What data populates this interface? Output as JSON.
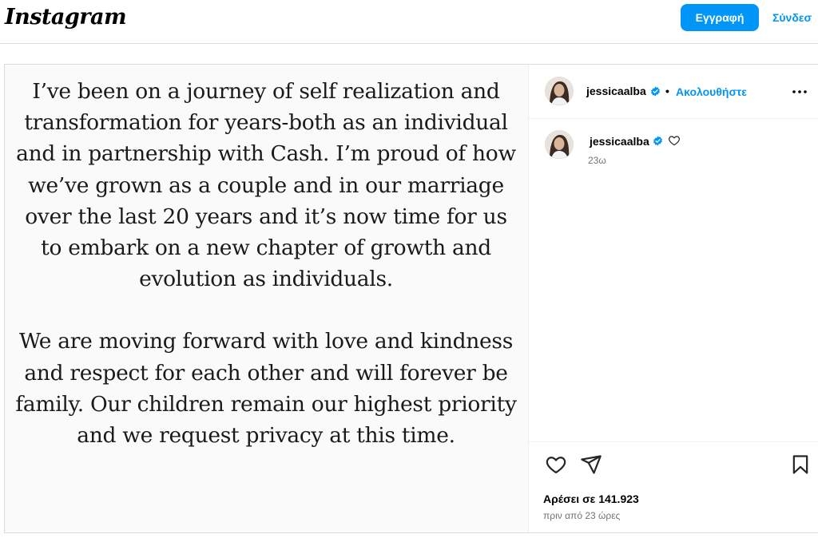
{
  "header": {
    "logo_text": "Instagram",
    "signup_label": "Εγγραφή",
    "login_label": "Σύνδεσ"
  },
  "post": {
    "media_text": {
      "paragraph1": "I’ve been on a journey of self realization and transformation for years-both as an individual and in partnership with Cash. I’m proud of how we’ve grown as a couple and in our marriage over the last 20 years and it’s now time for us to embark on a new chapter of growth and evolution as individuals.",
      "paragraph2": "We are moving forward with love and kindness and respect for each other and will forever be family. Our children remain our highest priority and we request privacy at this time."
    },
    "author": {
      "username": "jessicaalba",
      "verified": true,
      "separator": "•",
      "follow_label": "Ακολουθήστε"
    },
    "caption": {
      "username": "jessicaalba",
      "time_ago": "23ω"
    },
    "likes_text": "Αρέσει σε 141.923",
    "posted_ago": "πριν από 23 ώρες"
  },
  "icons": {
    "more": "more-options-icon",
    "verified": "verified-badge-icon",
    "like": "heart-icon",
    "share": "paper-plane-icon",
    "save": "bookmark-icon"
  },
  "colors": {
    "accent": "#0095f6",
    "border": "#dbdbdb",
    "secondary_text": "#737373",
    "media_bg": "#fafafa"
  }
}
